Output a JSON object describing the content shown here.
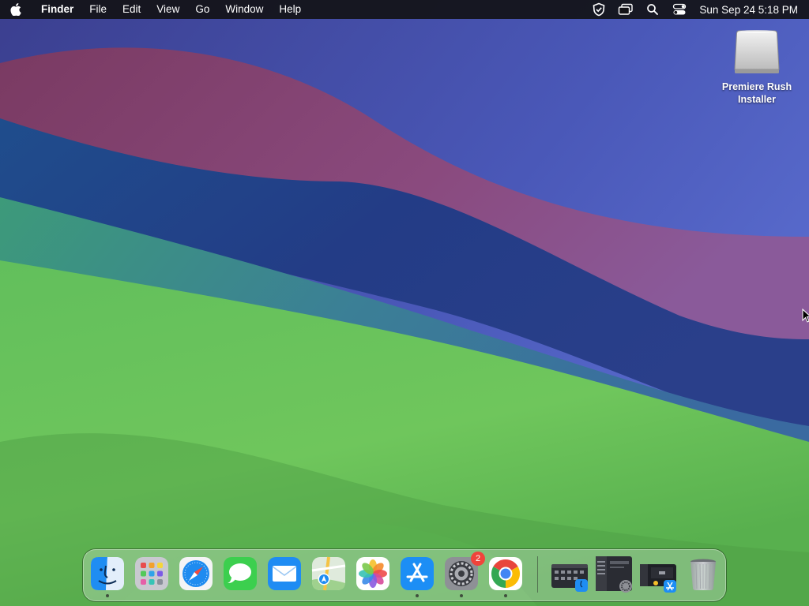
{
  "menubar": {
    "apple_icon": "apple-logo-icon",
    "app_name": "Finder",
    "menus": [
      "File",
      "Edit",
      "View",
      "Go",
      "Window",
      "Help"
    ],
    "status_icons": [
      "vpn-shield-icon",
      "screen-mirroring-icon",
      "spotlight-search-icon",
      "control-center-icon"
    ],
    "clock": "Sun Sep 24  5:18 PM"
  },
  "desktop": {
    "items": [
      {
        "label": "Premiere Rush\nInstaller",
        "icon": "disk-image-icon"
      }
    ]
  },
  "dock": {
    "apps": [
      {
        "name": "Finder",
        "icon": "finder-icon",
        "running": true
      },
      {
        "name": "Launchpad",
        "icon": "launchpad-icon",
        "running": false
      },
      {
        "name": "Safari",
        "icon": "safari-icon",
        "running": false
      },
      {
        "name": "Messages",
        "icon": "messages-icon",
        "running": false
      },
      {
        "name": "Mail",
        "icon": "mail-icon",
        "running": false
      },
      {
        "name": "Maps",
        "icon": "maps-icon",
        "running": false
      },
      {
        "name": "Photos",
        "icon": "photos-icon",
        "running": false
      },
      {
        "name": "App Store",
        "icon": "app-store-icon",
        "running": true
      },
      {
        "name": "System Settings",
        "icon": "system-settings-icon",
        "running": true,
        "badge": "2"
      },
      {
        "name": "Google Chrome",
        "icon": "chrome-icon",
        "running": true
      }
    ],
    "minimized": [
      {
        "icon": "minimized-window-finder-icon"
      },
      {
        "icon": "minimized-window-settings-icon"
      },
      {
        "icon": "minimized-window-app-store-icon"
      }
    ],
    "trash": {
      "icon": "trash-icon"
    }
  },
  "colors": {
    "menubar_bg": "#121216",
    "badge": "#f0443b",
    "accent_blue": "#1a8cff"
  }
}
